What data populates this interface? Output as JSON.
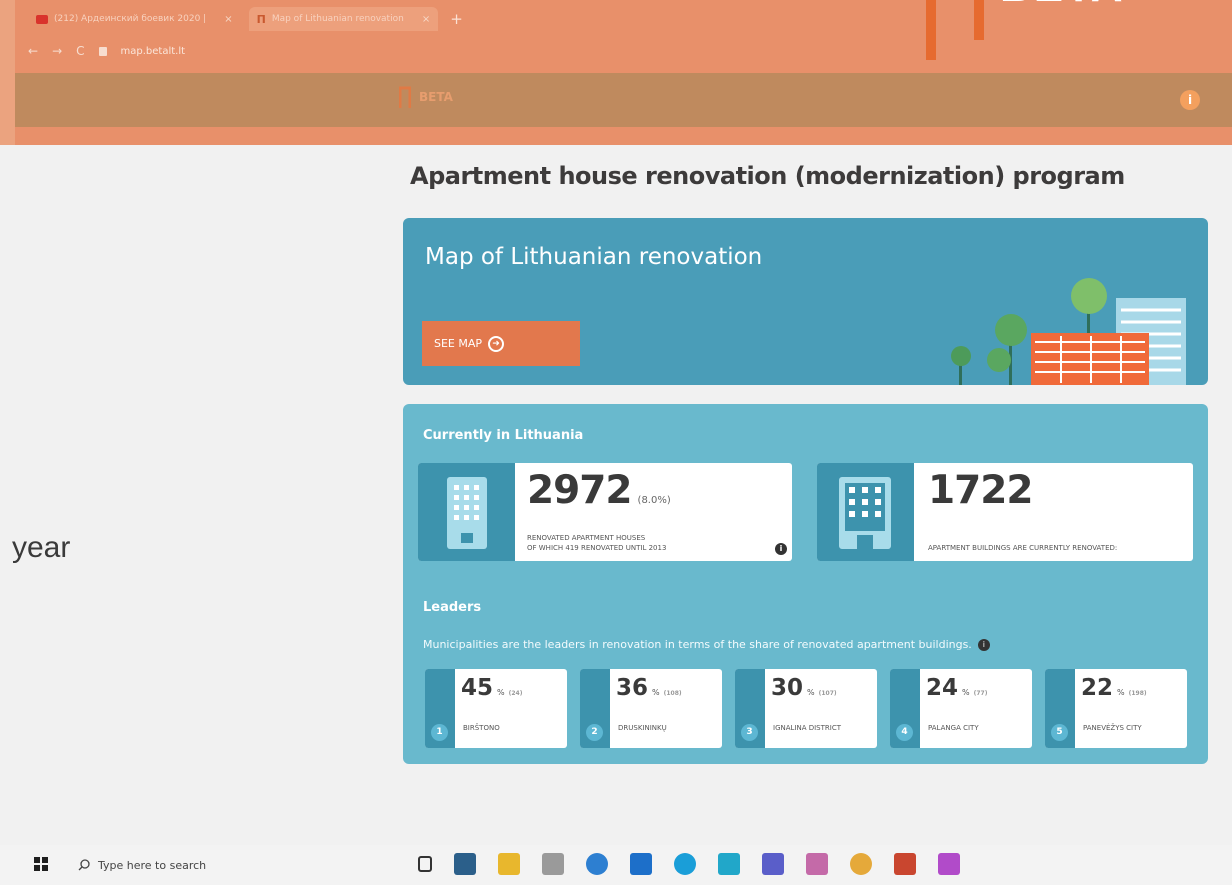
{
  "browser": {
    "tabs": [
      {
        "title": "(212) Ардеинский боевик 2020 |",
        "active": false
      },
      {
        "title": "Map of Lithuanian renovation",
        "active": true
      }
    ],
    "new_tab": "+",
    "close_glyph": "×",
    "nav": {
      "back": "←",
      "forward": "→",
      "reload": "C"
    },
    "url": "map.betalt.lt"
  },
  "overlay_logo": {
    "text": "BETA"
  },
  "site_header": {
    "beta_label": "BETA",
    "info_glyph": "i"
  },
  "side_text": "year",
  "page_title": "Apartment house renovation (modernization) program",
  "map_card": {
    "title": "Map of Lithuanian renovation",
    "button_label": "SEE MAP",
    "button_icon": "arrow-circle-icon"
  },
  "current": {
    "heading": "Currently in Lithuania",
    "stat1": {
      "number": "2972",
      "percent": "(8.0%)",
      "desc_line1": "Renovated apartment houses",
      "desc_line2": "of which 419 renovated until 2013",
      "info": "i"
    },
    "stat2": {
      "number": "1722",
      "desc": "Apartment buildings are currently renovated:"
    }
  },
  "leaders": {
    "heading": "Leaders",
    "description": "Municipalities are the leaders in renovation in terms of the share of renovated apartment buildings.",
    "info": "i",
    "items": [
      {
        "rank": "1",
        "value": "45",
        "unit": "%",
        "count": "(24)",
        "name": "Birštono"
      },
      {
        "rank": "2",
        "value": "36",
        "unit": "%",
        "count": "(108)",
        "name": "Druskininkų"
      },
      {
        "rank": "3",
        "value": "30",
        "unit": "%",
        "count": "(107)",
        "name": "Ignalina district"
      },
      {
        "rank": "4",
        "value": "24",
        "unit": "%",
        "count": "(77)",
        "name": "Palanga city"
      },
      {
        "rank": "5",
        "value": "22",
        "unit": "%",
        "count": "(198)",
        "name": "Panevėžys city"
      }
    ]
  },
  "taskbar": {
    "search_placeholder": "Type here to search",
    "apps": [
      "task-view-icon",
      "media-icon",
      "file-explorer-icon",
      "store-icon",
      "skype-icon",
      "outlook-icon",
      "edge-icon",
      "app-icon",
      "teams-icon",
      "onenote-icon",
      "chrome-icon",
      "powerpoint-icon",
      "onenote-purple-icon"
    ]
  },
  "colors": {
    "chrome": "#e8906a",
    "header": "#bf8a5e",
    "map_card": "#4a9db8",
    "stats_card": "#69b9cd",
    "icon_col": "#3d93ad",
    "button": "#e2784d"
  }
}
